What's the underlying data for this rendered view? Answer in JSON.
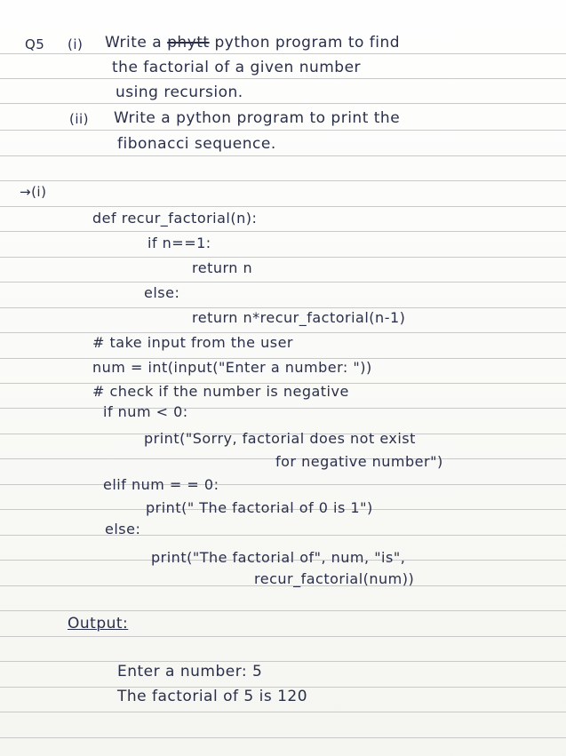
{
  "question": {
    "number": "Q5",
    "part1_marker": "(i)",
    "part1_line1_a": "Write a",
    "part1_line1_struck": "phytt",
    "part1_line1_b": "python program to find",
    "part1_line2": "the factorial of a given number",
    "part1_line3": "using recursion.",
    "part2_marker": "(ii)",
    "part2_line1": "Write a python program to print the",
    "part2_line2": "fibonacci sequence."
  },
  "answer": {
    "marker": "→(i)",
    "code_lines": [
      "def recur_factorial(n):",
      "if n==1:",
      "return n",
      "else:",
      "return n*recur_factorial(n-1)",
      "# take input from the user",
      "num = int(input(\"Enter a number: \"))",
      "# check if the number is negative",
      "if num < 0:",
      "print(\"Sorry, factorial does not exist",
      "for negative number\")",
      "elif num = = 0:",
      "print(\" The factorial of 0 is 1\")",
      "else:",
      "print(\"The factorial of\", num, \"is\",",
      "recur_factorial(num))"
    ]
  },
  "output": {
    "heading": "Output:",
    "line1": "Enter a number: 5",
    "line2": "The factorial of 5 is 120"
  }
}
